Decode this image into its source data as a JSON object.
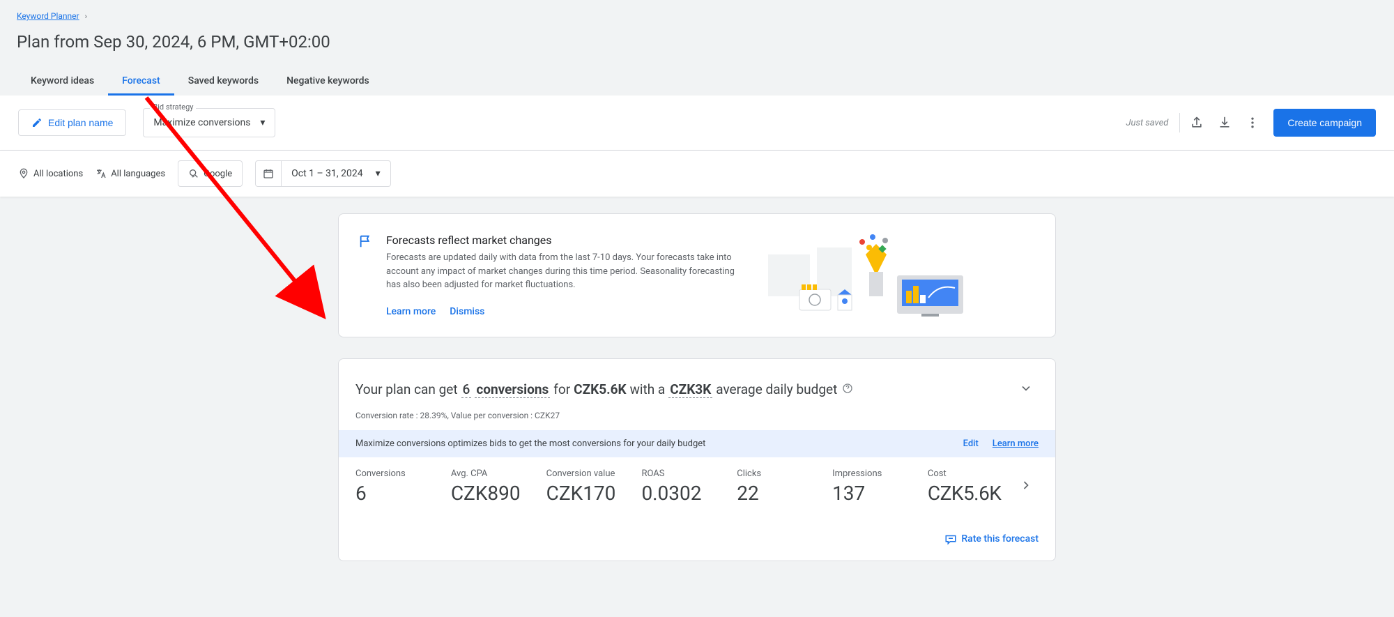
{
  "breadcrumb": {
    "label": "Keyword Planner"
  },
  "page_title": "Plan from Sep 30, 2024, 6 PM, GMT+02:00",
  "tabs": {
    "list": [
      {
        "label": "Keyword ideas",
        "active": false
      },
      {
        "label": "Forecast",
        "active": true
      },
      {
        "label": "Saved keywords",
        "active": false
      },
      {
        "label": "Negative keywords",
        "active": false
      }
    ]
  },
  "toolbar": {
    "edit_plan_label": "Edit plan name",
    "bid_strategy_label": "Bid strategy",
    "bid_strategy_value": "Maximize conversions",
    "saved_status": "Just saved",
    "create_campaign_label": "Create campaign"
  },
  "filters": {
    "locations": "All locations",
    "languages": "All languages",
    "network": "Google",
    "date_range": "Oct 1 – 31, 2024"
  },
  "notice": {
    "title": "Forecasts reflect market changes",
    "body": "Forecasts are updated daily with data from the last 7-10 days. Your forecasts take into account any impact of market changes during this time period. Seasonality forecasting has also been adjusted for market fluctuations.",
    "learn_more": "Learn more",
    "dismiss": "Dismiss"
  },
  "summary": {
    "sentence": {
      "prefix": "Your plan can get",
      "conversions_n": "6",
      "conversions_word": "conversions",
      "for": "for",
      "cost": "CZK5.6K",
      "with": "with a",
      "budget": "CZK3K",
      "suffix": "average daily budget"
    },
    "subline": "Conversion rate : 28.39%, Value per conversion : CZK27",
    "blue_bar": {
      "text": "Maximize conversions optimizes bids to get the most conversions for your daily budget",
      "edit": "Edit",
      "learn": "Learn more"
    },
    "metrics": [
      {
        "label": "Conversions",
        "value": "6"
      },
      {
        "label": "Avg. CPA",
        "value": "CZK890"
      },
      {
        "label": "Conversion value",
        "value": "CZK170"
      },
      {
        "label": "ROAS",
        "value": "0.0302"
      },
      {
        "label": "Clicks",
        "value": "22"
      },
      {
        "label": "Impressions",
        "value": "137"
      },
      {
        "label": "Cost",
        "value": "CZK5.6K"
      }
    ],
    "rate_label": "Rate this forecast"
  }
}
